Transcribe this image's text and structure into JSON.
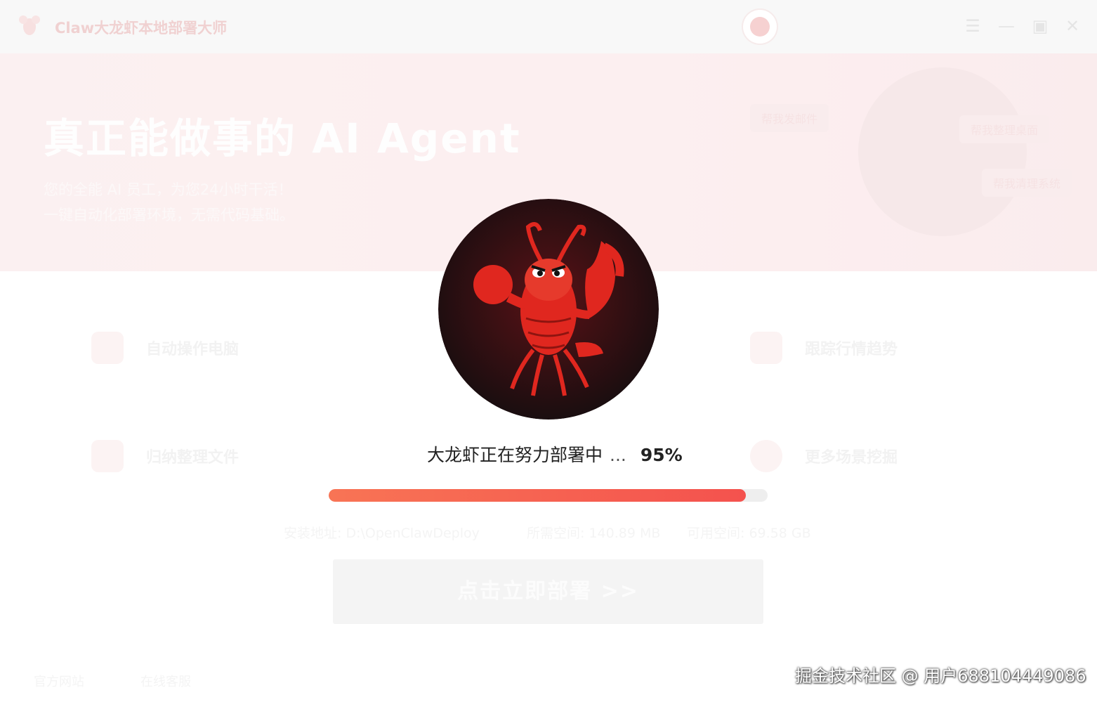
{
  "window": {
    "title": "Claw大龙虾本地部署大师",
    "controls": {
      "menu_icon": "☰",
      "minimize_icon": "—",
      "maximize_icon": "▣",
      "close_icon": "✕"
    }
  },
  "hero": {
    "title": "真正能做事的 AI Agent",
    "subtitle_line1": "您的全能 AI 员工，为您24小时干活！",
    "subtitle_line2": "一键自动化部署环境，无需代码基础。",
    "tags": [
      "帮我发邮件",
      "帮我整理桌面",
      "帮我清理系统"
    ]
  },
  "features": [
    {
      "label": "自动操作电脑",
      "icon": "monitor-icon"
    },
    {
      "label": "跟踪行情趋势",
      "icon": "chart-icon"
    },
    {
      "label": "归纳整理文件",
      "icon": "files-icon"
    },
    {
      "label": "更多场景挖掘",
      "icon": "plus-icon"
    }
  ],
  "install_info": {
    "path": "安装地址: D:\\OpenClawDeploy",
    "required_space": "所需空间: 140.89 MB",
    "available_space": "可用空间: 69.58 GB"
  },
  "deploy_button": {
    "label": "点击立即部署 >>"
  },
  "footer": {
    "official_site": "官方网站",
    "online_support": "在线客服"
  },
  "loading": {
    "status_text": "大龙虾正在努力部署中",
    "ellipsis": "...",
    "percent_text": "95%",
    "progress": 0.95
  },
  "watermark": "掘金技术社区 @ 用户688104449086",
  "colors": {
    "accent": "#f4524e",
    "accent_start": "#f87455",
    "mascot_bg": "#1e1214",
    "lobster": "#e0271f"
  }
}
